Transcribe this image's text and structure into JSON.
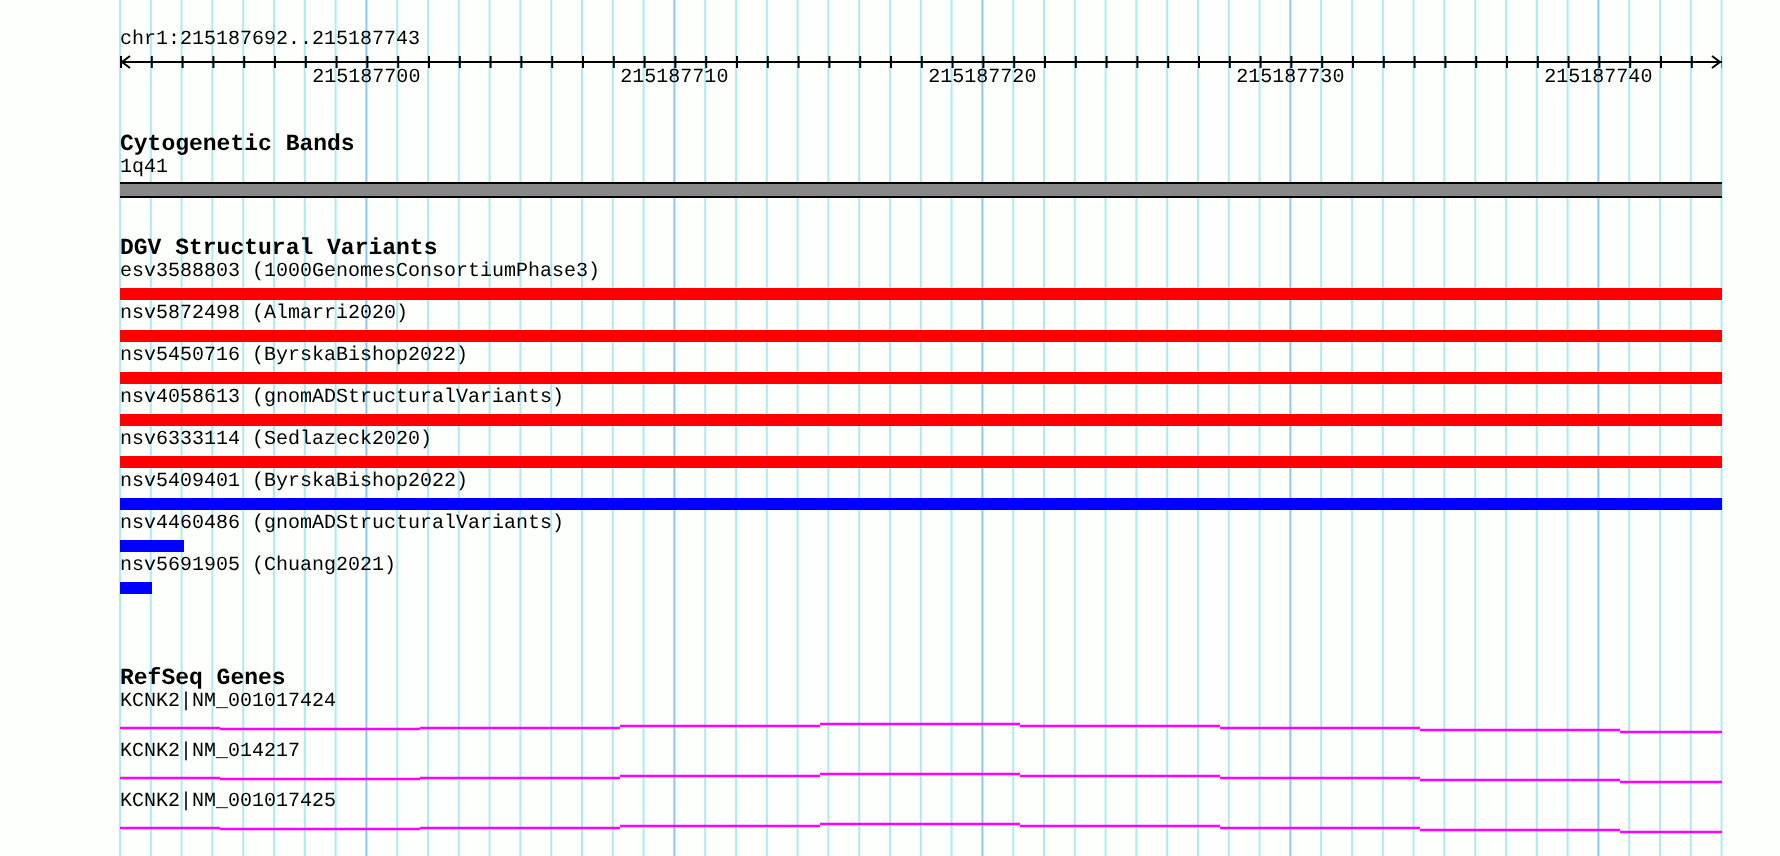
{
  "ruler": {
    "region": "chr1:215187692..215187743",
    "ticks": [
      {
        "label": "215187700"
      },
      {
        "label": "215187710"
      },
      {
        "label": "215187720"
      },
      {
        "label": "215187730"
      },
      {
        "label": "215187740"
      }
    ]
  },
  "cytogenetic_bands": {
    "title": "Cytogenetic Bands",
    "bands": [
      {
        "label": "1q41"
      }
    ]
  },
  "dgv_structural_variants": {
    "title": "DGV Structural Variants",
    "variants": [
      {
        "label": "esv3588803 (1000GenomesConsortiumPhase3)",
        "color": "#ff0000"
      },
      {
        "label": "nsv5872498 (Almarri2020)",
        "color": "#ff0000"
      },
      {
        "label": "nsv5450716 (ByrskaBishop2022)",
        "color": "#ff0000"
      },
      {
        "label": "nsv4058613 (gnomADStructuralVariants)",
        "color": "#ff0000"
      },
      {
        "label": "nsv6333114 (Sedlazeck2020)",
        "color": "#ff0000"
      },
      {
        "label": "nsv5409401 (ByrskaBishop2022)",
        "color": "#0000ff"
      },
      {
        "label": "nsv4460486 (gnomADStructuralVariants)",
        "color": "#0000ff",
        "level": 0.04
      },
      {
        "label": "nsv5691905 (Chuang2021)",
        "color": "#0000ff",
        "level": 0.02
      }
    ]
  },
  "refseq_genes": {
    "title": "RefSeq Genes",
    "genes": [
      {
        "label": "KCNK2|NM_001017424"
      },
      {
        "label": "KCNK2|NM_014217"
      },
      {
        "label": "KCNK2|NM_001017425"
      }
    ]
  }
}
